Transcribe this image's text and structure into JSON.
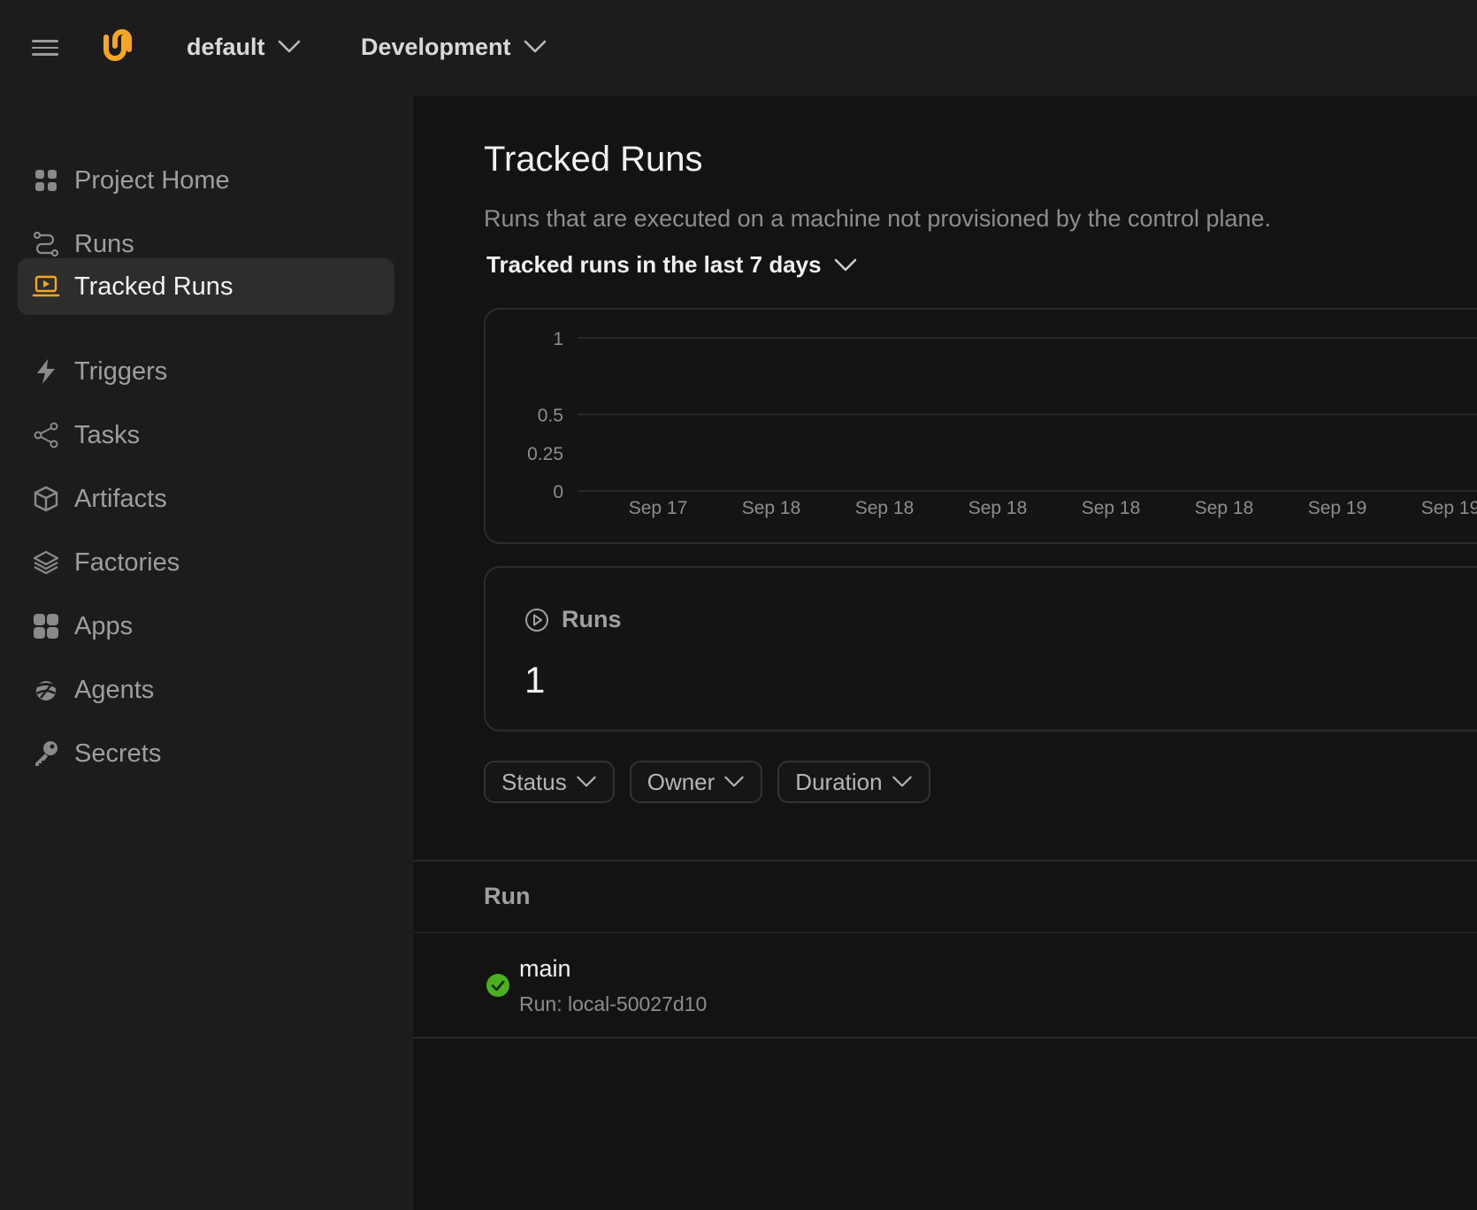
{
  "topbar": {
    "project": "default",
    "environment": "Development"
  },
  "sidebar": {
    "items": [
      {
        "label": "Project Home",
        "icon": "grid-icon"
      },
      {
        "label": "Runs",
        "icon": "route-icon"
      },
      {
        "label": "Tracked Runs",
        "icon": "laptop-play-icon",
        "active": true
      },
      {
        "label": "Triggers",
        "icon": "lightning-icon"
      },
      {
        "label": "Tasks",
        "icon": "share-nodes-icon"
      },
      {
        "label": "Artifacts",
        "icon": "cube-icon"
      },
      {
        "label": "Factories",
        "icon": "layers-icon"
      },
      {
        "label": "Apps",
        "icon": "apps-grid-icon"
      },
      {
        "label": "Agents",
        "icon": "agent-icon"
      },
      {
        "label": "Secrets",
        "icon": "key-icon"
      }
    ]
  },
  "main": {
    "title": "Tracked Runs",
    "description": "Runs that are executed on a machine not provisioned by the control plane.",
    "range_label": "Tracked runs in the last 7 days",
    "metric": {
      "label": "Runs",
      "value": "1"
    },
    "filters": [
      "Status",
      "Owner",
      "Duration"
    ],
    "table": {
      "column": "Run",
      "rows": [
        {
          "name": "main",
          "run_id": "Run: local-50027d10",
          "status": "success"
        }
      ]
    }
  },
  "colors": {
    "accent": "#f5a623",
    "success": "#4caf1f",
    "background": "#131313",
    "sidebar": "#1c1c1c"
  },
  "chart_data": {
    "type": "bar",
    "categories": [
      "Sep 17",
      "Sep 18",
      "Sep 18",
      "Sep 18",
      "Sep 18",
      "Sep 18",
      "Sep 19",
      "Sep 19"
    ],
    "values": [
      0,
      0,
      0,
      0,
      0,
      0,
      0,
      0
    ],
    "y_ticks": [
      "0",
      "0.25",
      "0.5",
      "1"
    ],
    "ylim": [
      0,
      1
    ],
    "grid": true
  }
}
